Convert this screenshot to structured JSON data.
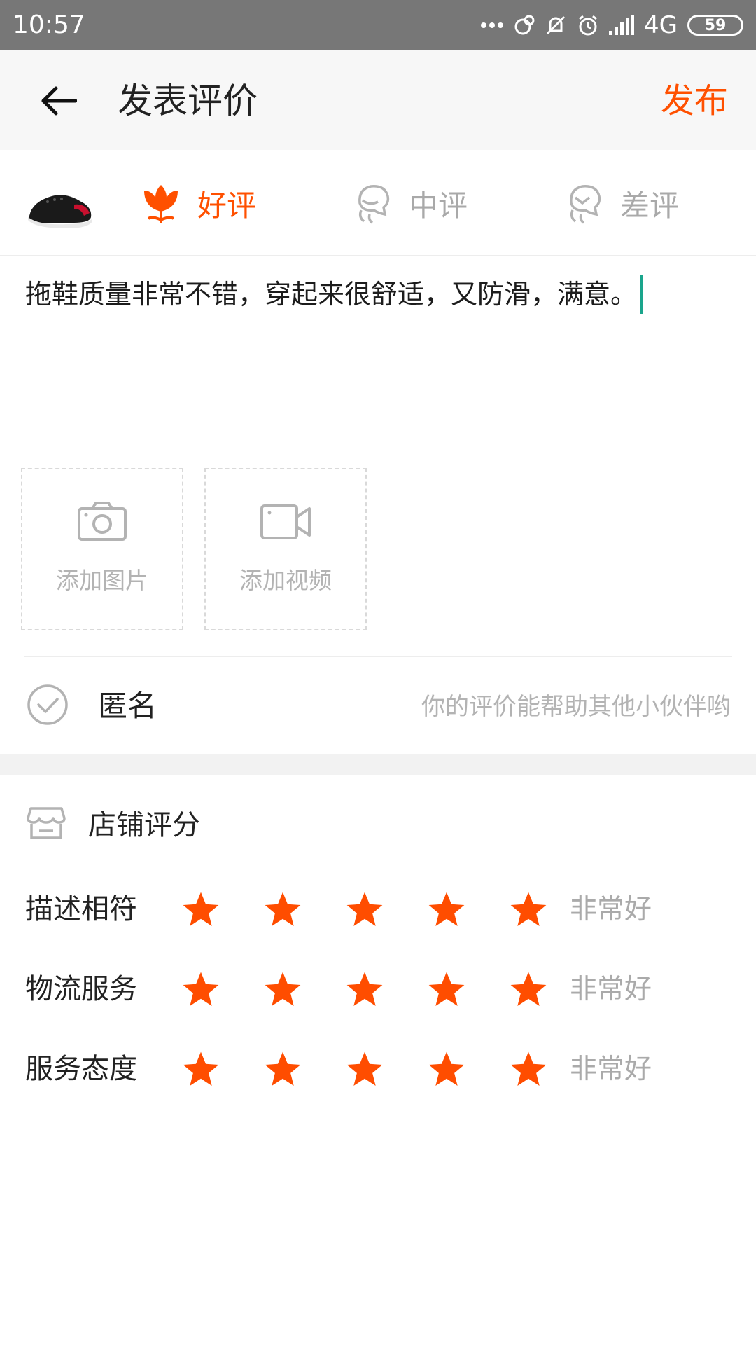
{
  "status_bar": {
    "time": "10:57",
    "network": "4G",
    "battery": "59",
    "icons": [
      "more-dots-icon",
      "sync-icon",
      "mute-icon",
      "alarm-icon",
      "signal-icon",
      "battery-icon"
    ]
  },
  "header": {
    "title": "发表评价",
    "publish_label": "发布",
    "back_icon": "back-arrow-icon"
  },
  "rating_type": {
    "selected": "good",
    "options": [
      {
        "id": "good",
        "label": "好评",
        "icon": "flower-icon"
      },
      {
        "id": "neutral",
        "label": "中评",
        "icon": "neutral-face-icon"
      },
      {
        "id": "bad",
        "label": "差评",
        "icon": "bad-face-icon"
      }
    ]
  },
  "review": {
    "text": "拖鞋质量非常不错，穿起来很舒适，又防滑，满意。"
  },
  "media": {
    "add_photo_label": "添加图片",
    "add_video_label": "添加视频"
  },
  "anonymous": {
    "label": "匿名",
    "hint": "你的评价能帮助其他小伙伴哟"
  },
  "shop_rating": {
    "title": "店铺评分",
    "items": [
      {
        "label": "描述相符",
        "stars": 5,
        "max": 5,
        "text": "非常好"
      },
      {
        "label": "物流服务",
        "stars": 5,
        "max": 5,
        "text": "非常好"
      },
      {
        "label": "服务态度",
        "stars": 5,
        "max": 5,
        "text": "非常好"
      }
    ]
  },
  "colors": {
    "accent": "#ff5000",
    "star": "#ff4d00",
    "muted": "#b3b3b3",
    "status_bar": "#777777",
    "caret": "#1aa58c"
  }
}
